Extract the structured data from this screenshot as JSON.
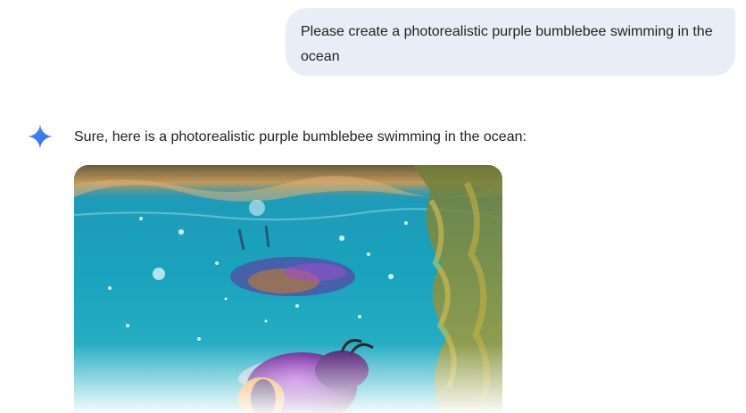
{
  "conversation": {
    "user_message": "Please create a photorealistic purple bumblebee swimming in the ocean",
    "assistant_message": "Sure, here is a photorealistic purple bumblebee swimming in the ocean:"
  },
  "icons": {
    "assistant_avatar": "sparkle-icon"
  },
  "colors": {
    "user_bubble": "#e9eef6",
    "text": "#1f1f1f",
    "spark_blue": "#4285f4"
  }
}
